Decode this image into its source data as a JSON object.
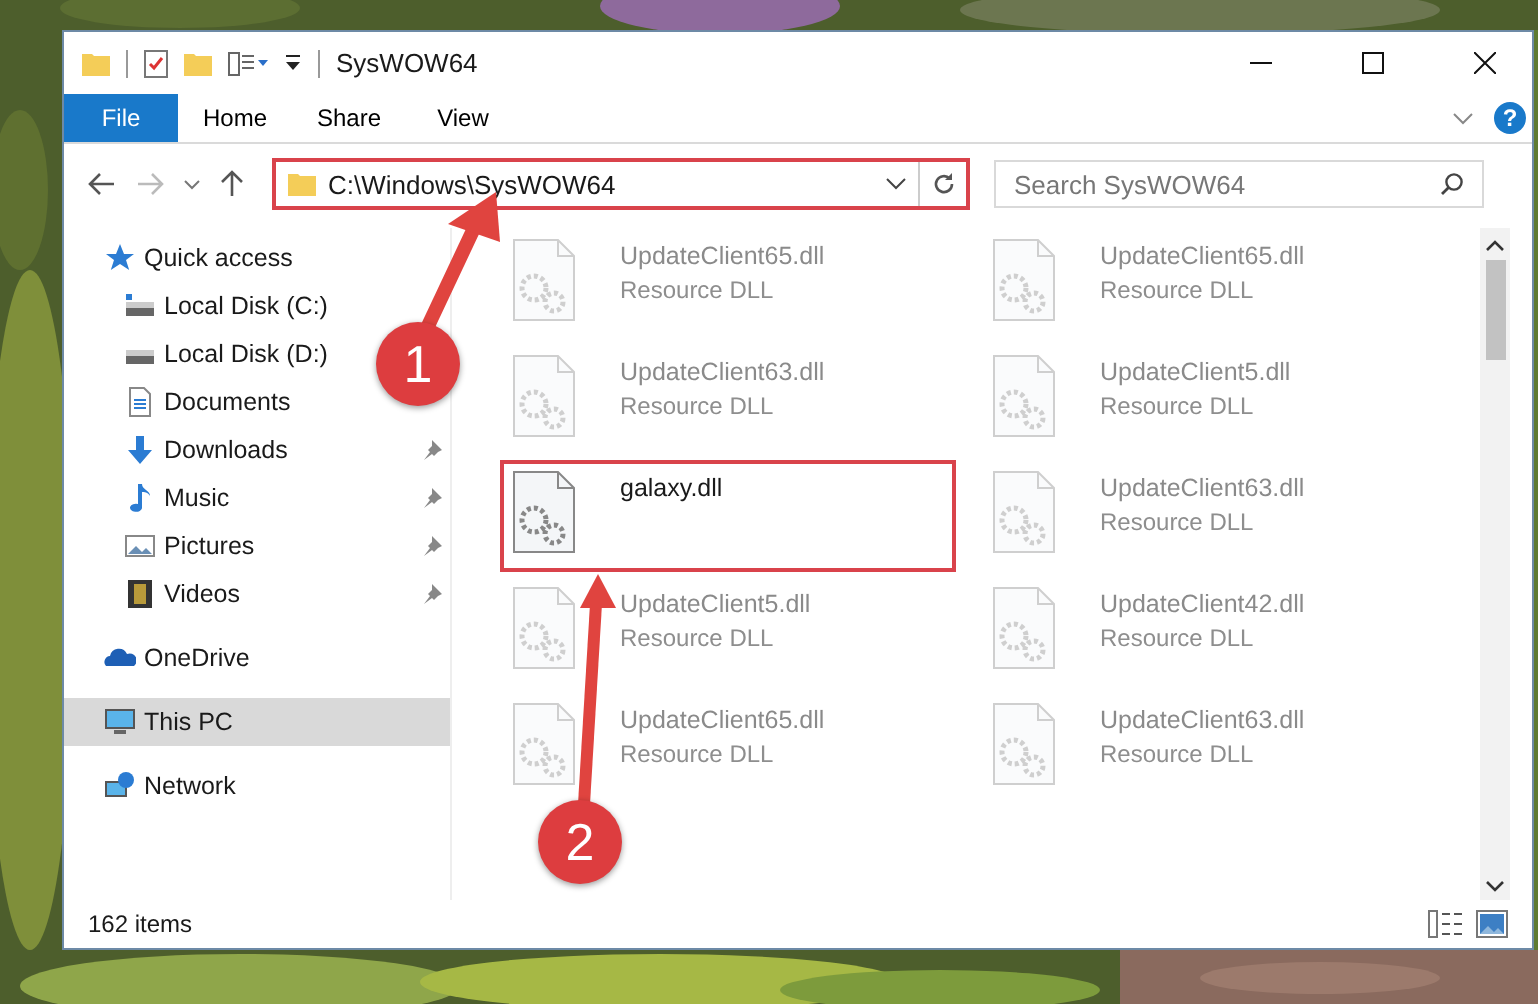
{
  "window": {
    "title": "SysWOW64"
  },
  "ribbon_tabs": [
    {
      "label": "File",
      "selected": true
    },
    {
      "label": "Home",
      "selected": false
    },
    {
      "label": "Share",
      "selected": false
    },
    {
      "label": "View",
      "selected": false
    }
  ],
  "ribbon_help": "?",
  "address": {
    "path": "C:\\Windows\\SysWOW64",
    "boxed": true
  },
  "search": {
    "placeholder": "Search SysWOW64"
  },
  "sidebar": {
    "items": [
      {
        "label": "Quick access",
        "kind": "star",
        "selected": false,
        "children": [
          {
            "label": "Local Disk (C:)",
            "kind": "disk-c",
            "selected": false,
            "pinned": false
          },
          {
            "label": "Local Disk (D:)",
            "kind": "disk",
            "selected": false,
            "pinned": false
          },
          {
            "label": "Documents",
            "kind": "documents",
            "selected": false,
            "pinned": false
          },
          {
            "label": "Downloads",
            "kind": "downloads",
            "selected": false,
            "pinned": true
          },
          {
            "label": "Music",
            "kind": "music",
            "selected": false,
            "pinned": true
          },
          {
            "label": "Pictures",
            "kind": "pictures",
            "selected": false,
            "pinned": true
          },
          {
            "label": "Videos",
            "kind": "videos",
            "selected": false,
            "pinned": true
          }
        ]
      },
      {
        "label": "OneDrive",
        "kind": "cloud",
        "selected": false
      },
      {
        "label": "This PC",
        "kind": "pc",
        "selected": true
      },
      {
        "label": "Network",
        "kind": "network",
        "selected": false
      }
    ]
  },
  "files": [
    {
      "name": "UpdateClient65.dll",
      "type": "Resource DLL",
      "faded": true,
      "boxed": false
    },
    {
      "name": "UpdateClient65.dll",
      "type": "Resource DLL",
      "faded": true,
      "boxed": false
    },
    {
      "name": "UpdateClient63.dll",
      "type": "Resource DLL",
      "faded": true,
      "boxed": false
    },
    {
      "name": "UpdateClient5.dll",
      "type": "Resource DLL",
      "faded": true,
      "boxed": false
    },
    {
      "name": "galaxy.dll",
      "faded": false,
      "boxed": true
    },
    {
      "name": "UpdateClient63.dll",
      "type": "Resource DLL",
      "faded": true,
      "boxed": false
    },
    {
      "name": "UpdateClient5.dll",
      "type": "Resource DLL",
      "faded": true,
      "boxed": false
    },
    {
      "name": "UpdateClient42.dll",
      "type": "Resource DLL",
      "faded": true,
      "boxed": false
    },
    {
      "name": "UpdateClient65.dll",
      "type": "Resource DLL",
      "faded": true,
      "boxed": false
    },
    {
      "name": "UpdateClient63.dll",
      "type": "Resource DLL",
      "faded": true,
      "boxed": false
    }
  ],
  "status_bar": {
    "count": "162 items"
  },
  "callouts": [
    {
      "label": "1"
    },
    {
      "label": "2"
    }
  ]
}
